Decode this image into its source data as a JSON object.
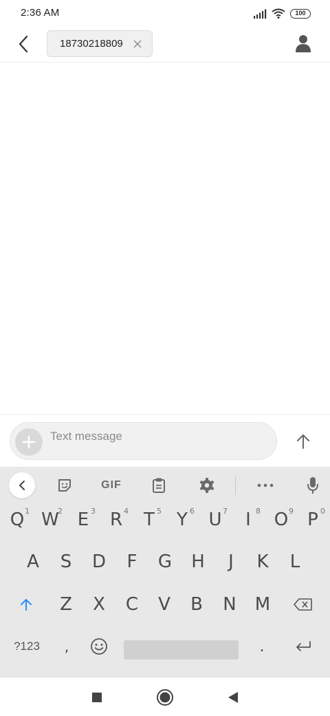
{
  "status_bar": {
    "time": "2:36 AM",
    "battery": "100",
    "icons": [
      "signal-icon",
      "wifi-icon",
      "battery-icon"
    ]
  },
  "header": {
    "recipient": "18730218809",
    "icons": [
      "back-arrow-icon",
      "close-icon",
      "contact-person-icon"
    ]
  },
  "compose": {
    "placeholder": "Text message",
    "icons": [
      "plus-icon",
      "send-arrow-up-icon"
    ]
  },
  "keyboard": {
    "toolbar": {
      "gif_label": "GIF",
      "icons": [
        "chevron-left-icon",
        "sticker-icon",
        "clipboard-icon",
        "gear-icon",
        "more-dots-icon",
        "microphone-icon"
      ]
    },
    "row1": [
      {
        "label": "Q",
        "hint": "1"
      },
      {
        "label": "W",
        "hint": "2"
      },
      {
        "label": "E",
        "hint": "3"
      },
      {
        "label": "R",
        "hint": "4"
      },
      {
        "label": "T",
        "hint": "5"
      },
      {
        "label": "Y",
        "hint": "6"
      },
      {
        "label": "U",
        "hint": "7"
      },
      {
        "label": "I",
        "hint": "8"
      },
      {
        "label": "O",
        "hint": "9"
      },
      {
        "label": "P",
        "hint": "0"
      }
    ],
    "row2": [
      "A",
      "S",
      "D",
      "F",
      "G",
      "H",
      "J",
      "K",
      "L"
    ],
    "row3": [
      "Z",
      "X",
      "C",
      "V",
      "B",
      "N",
      "M"
    ],
    "row4": {
      "symbols_label": "?123",
      "comma": ",",
      "period": "."
    },
    "icons": [
      "shift-arrow-icon",
      "backspace-icon",
      "emoji-icon",
      "enter-icon"
    ],
    "accent_color": "#2a8ef0"
  },
  "nav_bar": {
    "icons": [
      "recents-square-icon",
      "home-circle-icon",
      "back-triangle-icon"
    ]
  }
}
